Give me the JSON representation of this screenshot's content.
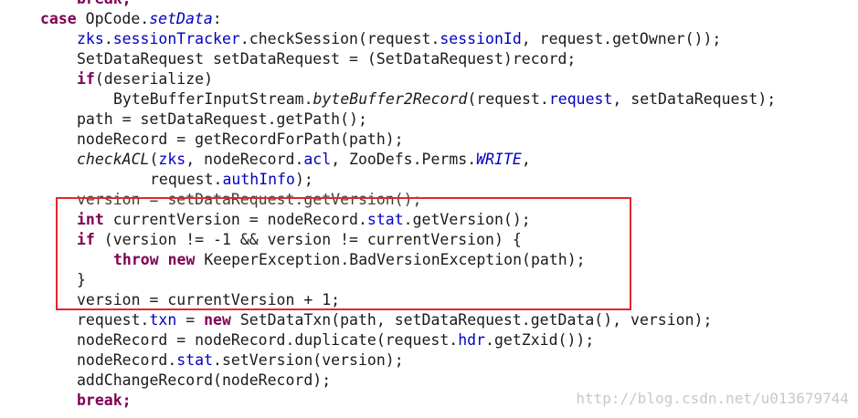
{
  "code": {
    "lines": [
      {
        "indent": 84,
        "segs": [
          {
            "t": "break;",
            "c": "kw"
          }
        ]
      },
      {
        "indent": 44,
        "segs": [
          {
            "t": "case",
            "c": "kw"
          },
          {
            "t": " OpCode."
          },
          {
            "t": "setData",
            "c": "ifield"
          },
          {
            "t": ":"
          }
        ]
      },
      {
        "indent": 84,
        "segs": [
          {
            "t": "zks",
            "c": "field"
          },
          {
            "t": "."
          },
          {
            "t": "sessionTracker",
            "c": "field"
          },
          {
            "t": ".checkSession(request."
          },
          {
            "t": "sessionId",
            "c": "field"
          },
          {
            "t": ", request.getOwner());"
          }
        ]
      },
      {
        "indent": 84,
        "segs": [
          {
            "t": "SetDataRequest setDataRequest = (SetDataRequest)record;"
          }
        ]
      },
      {
        "indent": 84,
        "segs": [
          {
            "t": "if",
            "c": "kw"
          },
          {
            "t": "(deserialize)"
          }
        ]
      },
      {
        "indent": 124,
        "segs": [
          {
            "t": "ByteBufferInputStream."
          },
          {
            "t": "byteBuffer2Record",
            "c": "italic"
          },
          {
            "t": "(request."
          },
          {
            "t": "request",
            "c": "field"
          },
          {
            "t": ", setDataRequest);"
          }
        ]
      },
      {
        "indent": 84,
        "segs": [
          {
            "t": "path = setDataRequest.getPath();"
          }
        ]
      },
      {
        "indent": 84,
        "segs": [
          {
            "t": "nodeRecord = getRecordForPath(path);"
          }
        ]
      },
      {
        "indent": 84,
        "segs": [
          {
            "t": "checkACL",
            "c": "italic"
          },
          {
            "t": "("
          },
          {
            "t": "zks",
            "c": "field"
          },
          {
            "t": ", nodeRecord."
          },
          {
            "t": "acl",
            "c": "field"
          },
          {
            "t": ", ZooDefs.Perms."
          },
          {
            "t": "WRITE",
            "c": "ifield"
          },
          {
            "t": ","
          }
        ]
      },
      {
        "indent": 164,
        "segs": [
          {
            "t": "request."
          },
          {
            "t": "authInfo",
            "c": "field"
          },
          {
            "t": ");"
          }
        ]
      },
      {
        "indent": 84,
        "segs": [
          {
            "t": "version = setDataRequest.getVersion();",
            "c": "faded"
          }
        ]
      },
      {
        "indent": 84,
        "segs": [
          {
            "t": "int",
            "c": "kw"
          },
          {
            "t": " currentVersion = nodeRecord."
          },
          {
            "t": "stat",
            "c": "field"
          },
          {
            "t": ".getVersion();"
          }
        ]
      },
      {
        "indent": 84,
        "segs": [
          {
            "t": "if",
            "c": "kw"
          },
          {
            "t": " (version != -1 && version != currentVersion) {"
          }
        ]
      },
      {
        "indent": 124,
        "segs": [
          {
            "t": "throw",
            "c": "kw"
          },
          {
            "t": " "
          },
          {
            "t": "new",
            "c": "kw"
          },
          {
            "t": " KeeperException.BadVersionException(path);"
          }
        ]
      },
      {
        "indent": 84,
        "segs": [
          {
            "t": "}"
          }
        ]
      },
      {
        "indent": 84,
        "segs": [
          {
            "t": "version = currentVersion + 1;"
          }
        ]
      },
      {
        "indent": 84,
        "segs": [
          {
            "t": "request."
          },
          {
            "t": "txn",
            "c": "field"
          },
          {
            "t": " = "
          },
          {
            "t": "new",
            "c": "kw"
          },
          {
            "t": " SetDataTxn(path, setDataRequest.getData(), version);"
          }
        ]
      },
      {
        "indent": 84,
        "segs": [
          {
            "t": "nodeRecord = nodeRecord.duplicate(request."
          },
          {
            "t": "hdr",
            "c": "field"
          },
          {
            "t": ".getZxid());"
          }
        ]
      },
      {
        "indent": 84,
        "segs": [
          {
            "t": "nodeRecord."
          },
          {
            "t": "stat",
            "c": "field"
          },
          {
            "t": ".setVersion(version);"
          }
        ]
      },
      {
        "indent": 84,
        "segs": [
          {
            "t": "addChangeRecord(nodeRecord);"
          }
        ]
      },
      {
        "indent": 84,
        "segs": [
          {
            "t": "break;",
            "c": "kw"
          }
        ]
      }
    ]
  },
  "watermark": "http://blog.csdn.net/u013679744",
  "colors": {
    "keyword": "#7f0055",
    "field": "#0000c0",
    "highlight_border": "#e0282f"
  }
}
